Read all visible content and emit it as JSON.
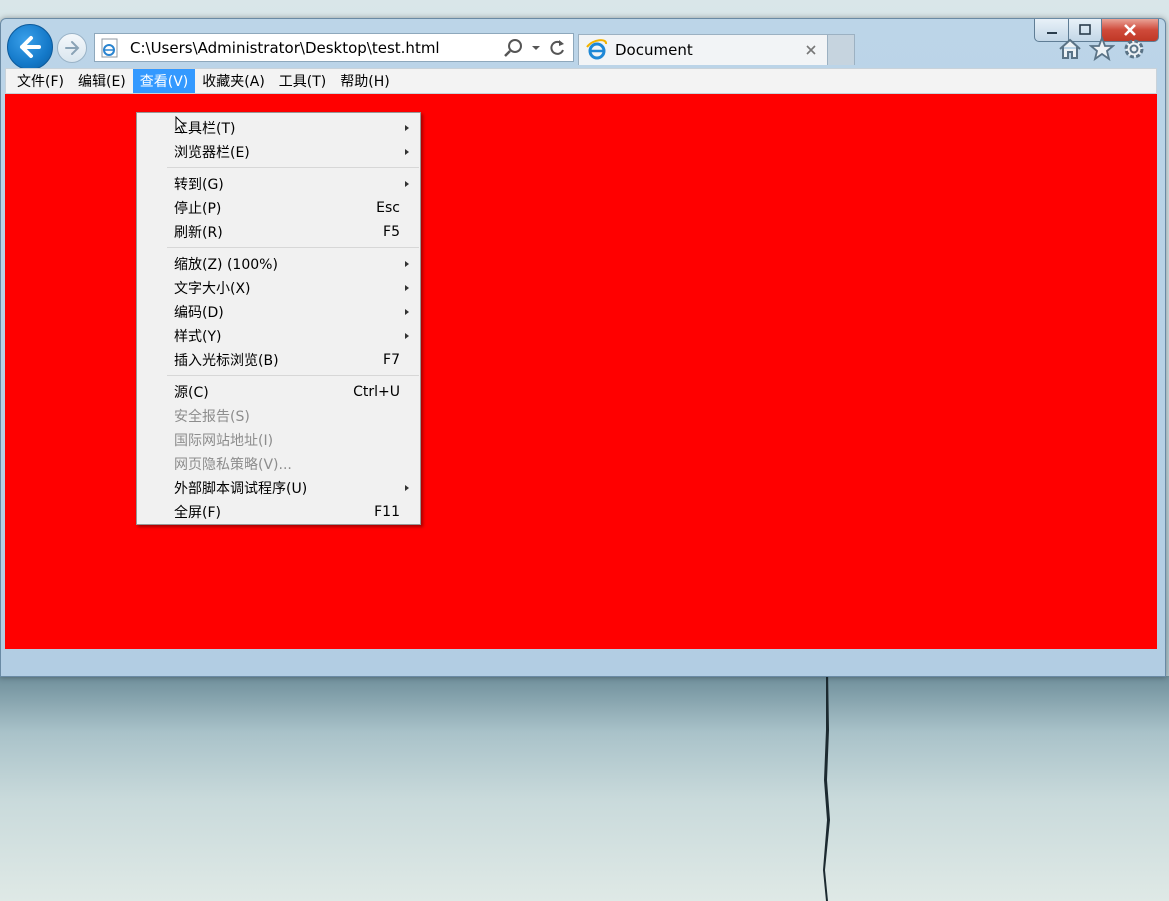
{
  "window": {
    "caption_buttons": [
      {
        "name": "minimize-button",
        "icon": "minimize-icon"
      },
      {
        "name": "maximize-button",
        "icon": "maximize-icon"
      },
      {
        "name": "close-button",
        "icon": "close-icon"
      }
    ],
    "colors": {
      "content_bg": "#ff0000",
      "menu_highlight": "#3399ff",
      "frame": "#b8d2e6"
    }
  },
  "nav": {
    "address": "C:\\Users\\Administrator\\Desktop\\test.html",
    "back_icon": "back-arrow-icon",
    "forward_icon": "forward-arrow-icon",
    "address_tools": [
      "search-icon",
      "dropdown-arrow-icon",
      "refresh-icon"
    ]
  },
  "tab": {
    "title": "Document",
    "icon": "ie-logo-icon",
    "close_icon": "close-icon"
  },
  "toolbar_icons": [
    "home-icon",
    "favorites-star-icon",
    "settings-gear-icon"
  ],
  "menu_bar": {
    "items": [
      "文件(F)",
      "编辑(E)",
      "查看(V)",
      "收藏夹(A)",
      "工具(T)",
      "帮助(H)"
    ],
    "active_index": 2
  },
  "view_menu": {
    "items": [
      {
        "label": "工具栏(T)",
        "shortcut": "",
        "submenu": true,
        "disabled": false
      },
      {
        "label": "浏览器栏(E)",
        "shortcut": "",
        "submenu": true,
        "disabled": false
      },
      {
        "label": "转到(G)",
        "shortcut": "",
        "submenu": true,
        "disabled": false
      },
      {
        "label": "停止(P)",
        "shortcut": "Esc",
        "submenu": false,
        "disabled": false
      },
      {
        "label": "刷新(R)",
        "shortcut": "F5",
        "submenu": false,
        "disabled": false
      },
      {
        "label": "缩放(Z) (100%)",
        "shortcut": "",
        "submenu": true,
        "disabled": false
      },
      {
        "label": "文字大小(X)",
        "shortcut": "",
        "submenu": true,
        "disabled": false
      },
      {
        "label": "编码(D)",
        "shortcut": "",
        "submenu": true,
        "disabled": false
      },
      {
        "label": "样式(Y)",
        "shortcut": "",
        "submenu": true,
        "disabled": false
      },
      {
        "label": "插入光标浏览(B)",
        "shortcut": "F7",
        "submenu": false,
        "disabled": false
      },
      {
        "label": "源(C)",
        "shortcut": "Ctrl+U",
        "submenu": false,
        "disabled": false
      },
      {
        "label": "安全报告(S)",
        "shortcut": "",
        "submenu": false,
        "disabled": true
      },
      {
        "label": "国际网站地址(I)",
        "shortcut": "",
        "submenu": false,
        "disabled": true
      },
      {
        "label": "网页隐私策略(V)...",
        "shortcut": "",
        "submenu": false,
        "disabled": true
      },
      {
        "label": "外部脚本调试程序(U)",
        "shortcut": "",
        "submenu": true,
        "disabled": false
      },
      {
        "label": "全屏(F)",
        "shortcut": "F11",
        "submenu": false,
        "disabled": false
      }
    ]
  }
}
